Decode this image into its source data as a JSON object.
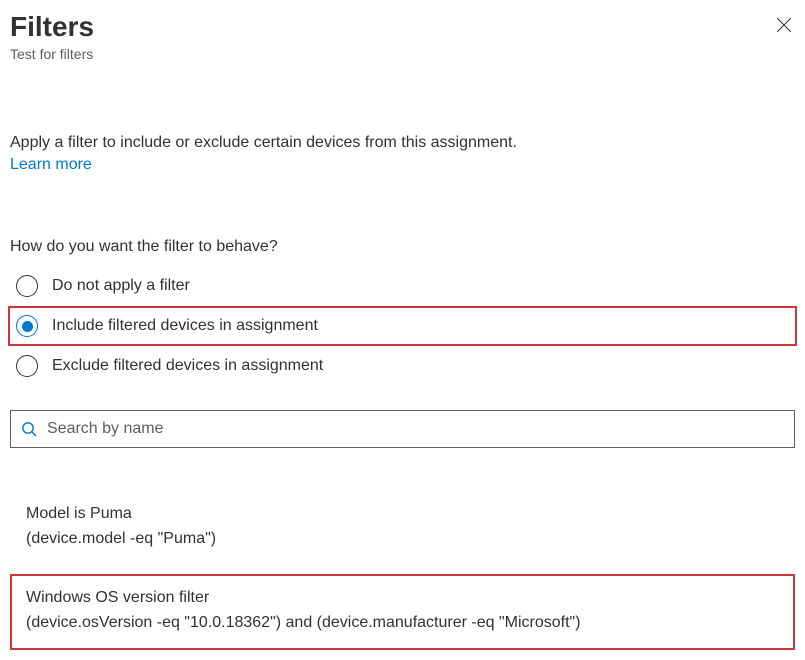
{
  "header": {
    "title": "Filters",
    "subtitle": "Test for filters"
  },
  "intro": {
    "text": "Apply a filter to include or exclude certain devices from this assignment.",
    "learn_more": "Learn more"
  },
  "behave": {
    "label": "How do you want the filter to behave?",
    "options": [
      {
        "label": "Do not apply a filter",
        "selected": false,
        "highlight": false
      },
      {
        "label": "Include filtered devices in assignment",
        "selected": true,
        "highlight": true
      },
      {
        "label": "Exclude filtered devices in assignment",
        "selected": false,
        "highlight": false
      }
    ]
  },
  "search": {
    "placeholder": "Search by name",
    "value": ""
  },
  "filters": [
    {
      "name": "Model is Puma",
      "expr": "(device.model -eq \"Puma\")",
      "highlight": false
    },
    {
      "name": "Windows OS version filter",
      "expr": "(device.osVersion -eq \"10.0.18362\") and (device.manufacturer -eq \"Microsoft\")",
      "highlight": true
    }
  ]
}
